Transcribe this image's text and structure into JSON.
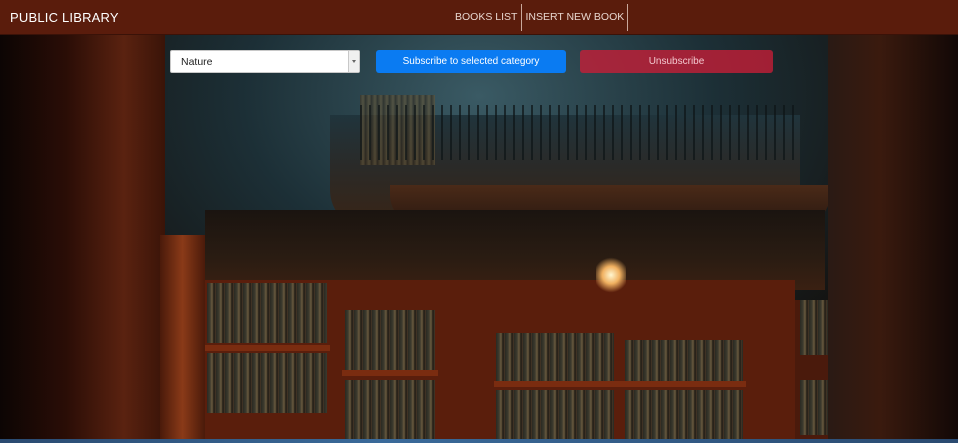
{
  "navbar": {
    "brand": "PUBLIC LIBRARY",
    "links": [
      {
        "label": "BOOKS LIST"
      },
      {
        "label": "INSERT NEW BOOK"
      }
    ],
    "background_color": "#5a1c0c"
  },
  "subscription": {
    "category_select": {
      "selected": "Nature"
    },
    "subscribe_button": {
      "label": "Subscribe to selected category",
      "color": "#0a7bf2"
    },
    "unsubscribe_button": {
      "label": "Unsubscribe",
      "color": "#c81e37"
    }
  },
  "icons": {
    "select_arrow": "chevron-down-icon"
  }
}
